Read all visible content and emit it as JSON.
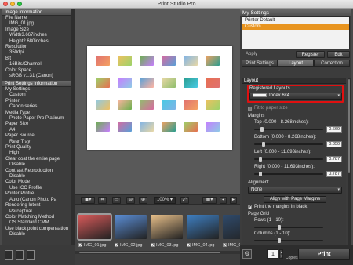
{
  "window": {
    "title": "Print Studio Pro"
  },
  "left_panel": {
    "image_info_header": "Image Information",
    "image_info": [
      {
        "text": "File Name",
        "indent": false
      },
      {
        "text": "IMG_01.jpg",
        "indent": true
      },
      {
        "text": "Image Size",
        "indent": false
      },
      {
        "text": "Width3.667inches",
        "indent": true
      },
      {
        "text": "Height2.680inches",
        "indent": true
      },
      {
        "text": "Resolution",
        "indent": false
      },
      {
        "text": "350dpi",
        "indent": true
      },
      {
        "text": "Bit",
        "indent": false
      },
      {
        "text": "16Bits/Channel",
        "indent": true
      },
      {
        "text": "Color Space",
        "indent": false
      },
      {
        "text": "sRGB v1.31 (Canon)",
        "indent": true
      }
    ],
    "print_settings_header": "Print Settings Information",
    "print_settings": [
      {
        "text": "My Settings",
        "indent": false
      },
      {
        "text": "Custom",
        "indent": true
      },
      {
        "text": "Printer",
        "indent": false
      },
      {
        "text": "Canon                 series",
        "indent": true
      },
      {
        "text": "Media Type",
        "indent": false
      },
      {
        "text": "Photo Paper Pro Platinum",
        "indent": true
      },
      {
        "text": "Paper Size",
        "indent": false
      },
      {
        "text": "A4",
        "indent": true
      },
      {
        "text": "Paper Source",
        "indent": false
      },
      {
        "text": "Rear Tray",
        "indent": true
      },
      {
        "text": "Print Quality",
        "indent": false
      },
      {
        "text": "High",
        "indent": true
      },
      {
        "text": "Clear coat the entire page",
        "indent": false
      },
      {
        "text": "Disable",
        "indent": true
      },
      {
        "text": "Contrast Reproduction",
        "indent": false
      },
      {
        "text": "Disable",
        "indent": true
      },
      {
        "text": "Color Mode",
        "indent": false
      },
      {
        "text": "Use ICC Profile",
        "indent": true
      },
      {
        "text": "Printer Profile",
        "indent": false
      },
      {
        "text": "Auto (Canon              Photo Pa",
        "indent": true
      },
      {
        "text": "Rendering Intent",
        "indent": false
      },
      {
        "text": "Perceptual",
        "indent": true
      },
      {
        "text": "Color Matching Method",
        "indent": false
      },
      {
        "text": "OS Standard CMM",
        "indent": true
      },
      {
        "text": "Use black point compensation",
        "indent": false
      },
      {
        "text": "Disable",
        "indent": true
      }
    ]
  },
  "toolbar": {
    "zoom": "100%"
  },
  "filmstrip": [
    {
      "name": "IMG_01.jpg",
      "checked": true,
      "color": "#d85a5a"
    },
    {
      "name": "IMG_02.jpg",
      "checked": true,
      "color": "#5b8ed6"
    },
    {
      "name": "IMG_03.jpg",
      "checked": true,
      "color": "#e8c08a"
    },
    {
      "name": "IMG_04.jpg",
      "checked": true,
      "color": "#3e7fc2"
    },
    {
      "name": "IMG_05.jpg",
      "checked": true,
      "color": "#2f4a6b"
    }
  ],
  "right_panel": {
    "my_settings_header": "My Settings",
    "settings_list": [
      "Printer Default",
      "Custom"
    ],
    "selected_setting": "Custom",
    "buttons": {
      "apply": "Apply",
      "register": "Register",
      "edit": "Edit"
    },
    "tabs": [
      "Print Settings",
      "Layout",
      "Correction"
    ],
    "active_tab": "Layout",
    "layout": {
      "header": "Layout",
      "registered_layouts_label": "Registered Layouts",
      "registered_layout_value": "Index 6x4",
      "fit_to_paper": "Fit to paper size",
      "margins_label": "Margins",
      "top_label": "Top (0.000 - 8.268inches):",
      "top_value": "0.669",
      "bottom_label": "Bottom (0.000 - 8.268inches):",
      "bottom_value": "0.850",
      "left_label": "Left (0.000 - 11.693inches):",
      "left_value": "0.787",
      "right_label": "Right (0.000 - 11.693inches):",
      "right_value": "0.787",
      "alignment_label": "Alignment",
      "alignment_value": "None",
      "align_margins_button": "Align with Page Margins",
      "print_margins_black": "Print the margins in black",
      "page_grid_label": "Page Grid",
      "rows_label": "Rows (1 - 10):",
      "columns_label": "Columns (1 - 10):"
    },
    "copies_value": "1",
    "copies_label": "Copies",
    "print_button": "Print"
  }
}
